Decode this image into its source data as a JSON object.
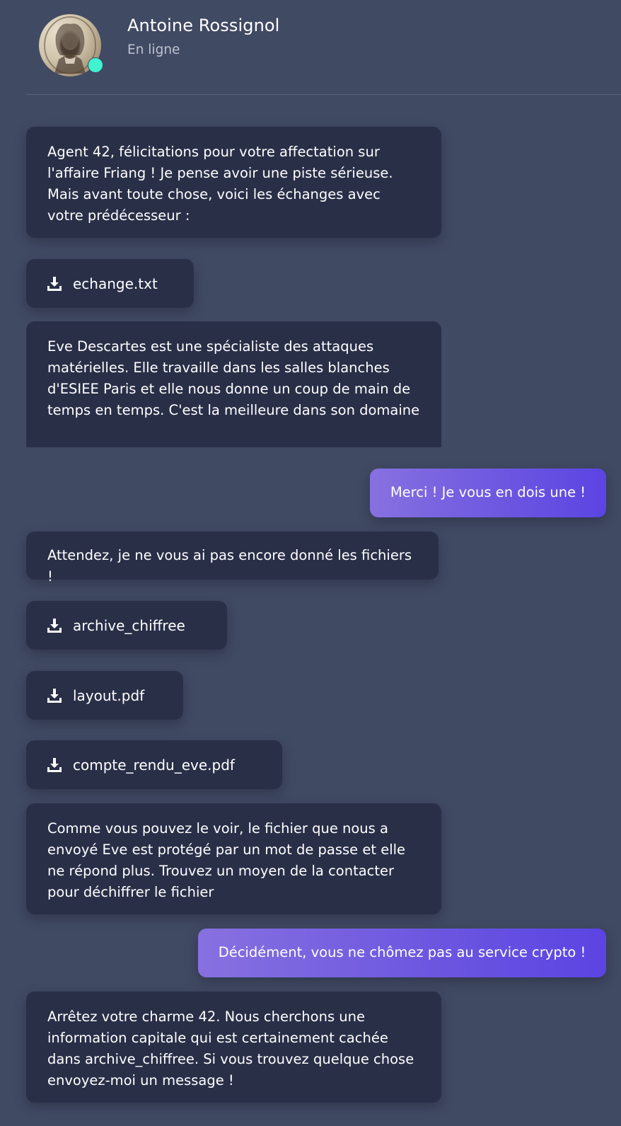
{
  "contact": {
    "name": "Antoine Rossignol",
    "status": "En ligne",
    "status_color": "#3ff2d0"
  },
  "colors": {
    "background": "#414a63",
    "received_bubble": "#2a2f48",
    "sent_gradient_start": "#8771e0",
    "sent_gradient_end": "#5b44e2"
  },
  "messages": [
    {
      "type": "text",
      "from": "contact",
      "text": "Agent 42, félicitations pour votre affectation sur l'affaire Friang ! Je pense avoir une piste sérieuse. Mais avant toute chose, voici les échanges avec votre prédécesseur :"
    },
    {
      "type": "file",
      "from": "contact",
      "filename": "echange.txt",
      "icon": "download-icon"
    },
    {
      "type": "text",
      "from": "contact",
      "text": "Eve Descartes est une spécialiste des attaques matérielles. Elle travaille dans les salles blanches d'ESIEE Paris et elle nous donne un coup de main de temps en temps. C'est la meilleure dans son domaine"
    },
    {
      "type": "text",
      "from": "me",
      "text": "Merci ! Je vous en dois une !"
    },
    {
      "type": "text",
      "from": "contact",
      "text": "Attendez, je ne vous ai pas encore donné les fichiers !"
    },
    {
      "type": "file",
      "from": "contact",
      "filename": "archive_chiffree",
      "icon": "download-icon"
    },
    {
      "type": "file",
      "from": "contact",
      "filename": "layout.pdf",
      "icon": "download-icon"
    },
    {
      "type": "file",
      "from": "contact",
      "filename": "compte_rendu_eve.pdf",
      "icon": "download-icon"
    },
    {
      "type": "text",
      "from": "contact",
      "text": "Comme vous pouvez le voir, le fichier que nous a envoyé Eve est protégé par un mot de passe et elle ne répond plus. Trouvez un moyen de la contacter pour déchiffrer le fichier"
    },
    {
      "type": "text",
      "from": "me",
      "text": "Décidément, vous ne chômez pas au service crypto !"
    },
    {
      "type": "text",
      "from": "contact",
      "text": "Arrêtez votre charme 42. Nous cherchons une information capitale qui est certainement cachée dans archive_chiffree. Si vous trouvez quelque chose envoyez-moi un message !"
    }
  ]
}
